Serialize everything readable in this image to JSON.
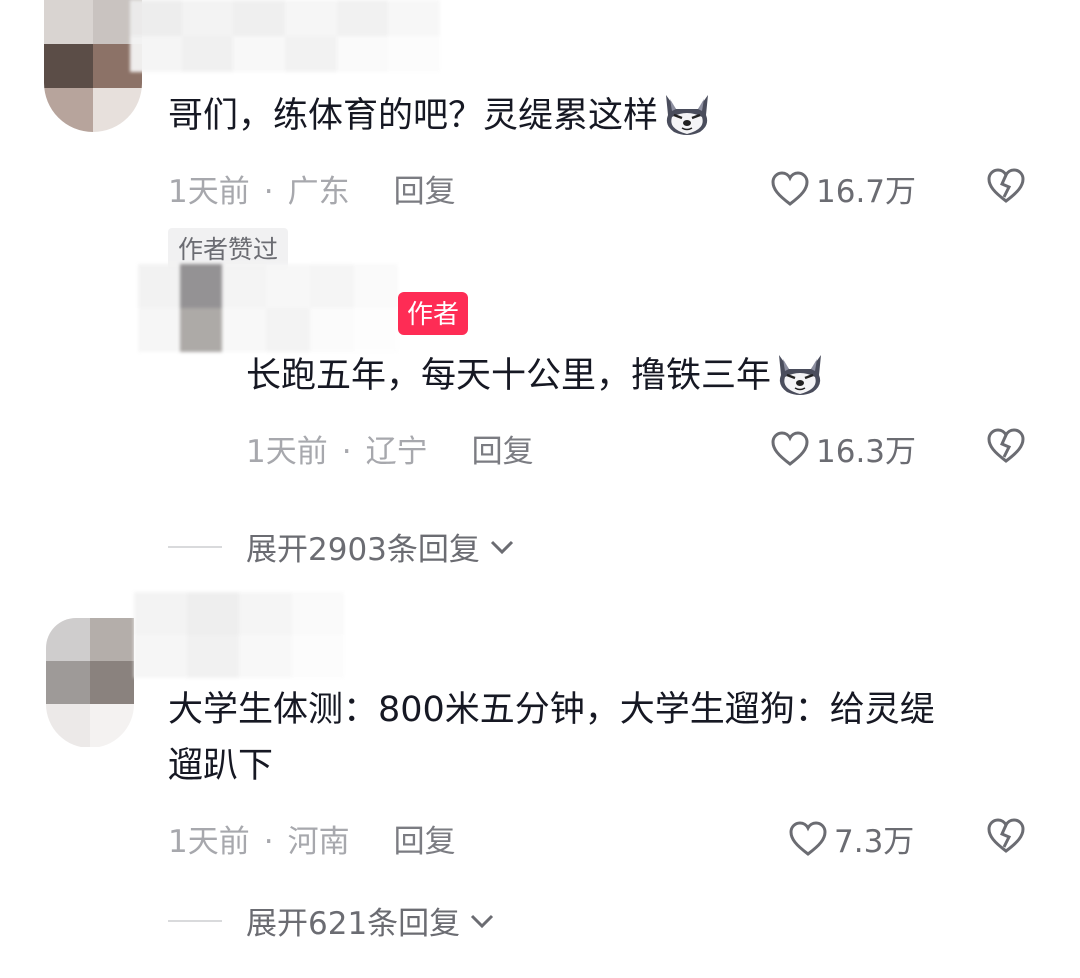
{
  "comments": [
    {
      "text": "哥们，练体育的吧？灵缇累这样",
      "time": "1天前",
      "location": "广东",
      "reply_label": "回复",
      "likes": "16.7万",
      "badge": "作者赞过",
      "emoji": "dog-emoji"
    },
    {
      "author_tag": "作者",
      "text": "长跑五年，每天十公里，撸铁三年",
      "time": "1天前",
      "location": "辽宁",
      "reply_label": "回复",
      "likes": "16.3万",
      "emoji": "dog-emoji"
    },
    {
      "text_line1": "大学生体测：800米五分钟，大学生遛狗：给灵缇",
      "text_line2": "遛趴下",
      "time": "1天前",
      "location": "河南",
      "reply_label": "回复",
      "likes": "7.3万"
    }
  ],
  "expand_replies": [
    {
      "label": "展开2903条回复"
    },
    {
      "label": "展开621条回复"
    }
  ],
  "separator_dot": "·",
  "icons": {
    "like": "heart-outline-icon",
    "dislike": "broken-heart-icon",
    "expand": "chevron-down-icon"
  },
  "colors": {
    "text_primary": "#161823",
    "text_secondary": "#a7a8ad",
    "author_badge": "#fe2c55"
  }
}
